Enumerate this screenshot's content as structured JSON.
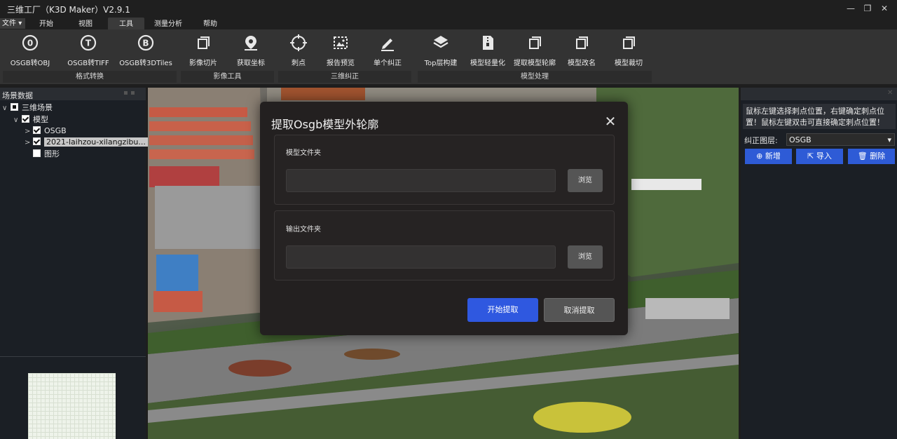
{
  "app": {
    "title": "三维工厂（K3D Maker）V2.9.1"
  },
  "menu": {
    "file": "文件",
    "tabs": [
      {
        "label": "开始"
      },
      {
        "label": "视图"
      },
      {
        "label": "工具",
        "active": true
      },
      {
        "label": "测量分析"
      },
      {
        "label": "帮助"
      }
    ]
  },
  "ribbon": {
    "buttons": [
      {
        "label": "OSGB转OBJ",
        "icon": "convert-o-icon"
      },
      {
        "label": "OSGB转TIFF",
        "icon": "convert-t-icon"
      },
      {
        "label": "OSGB转3DTiles",
        "icon": "convert-b-icon"
      },
      {
        "label": "影像切片",
        "icon": "slice-icon"
      },
      {
        "label": "获取坐标",
        "icon": "location-pin-icon"
      },
      {
        "label": "刺点",
        "icon": "crosshair-icon"
      },
      {
        "label": "报告预览",
        "icon": "image-preview-icon"
      },
      {
        "label": "单个纠正",
        "icon": "pencil-icon"
      },
      {
        "label": "Top层构建",
        "icon": "layers-icon"
      },
      {
        "label": "模型轻量化",
        "icon": "zip-file-icon"
      },
      {
        "label": "提取模型轮廓",
        "icon": "outline-icon"
      },
      {
        "label": "模型改名",
        "icon": "rename-icon"
      },
      {
        "label": "模型裁切",
        "icon": "crop-icon"
      }
    ],
    "groups": [
      {
        "label": "格式转换"
      },
      {
        "label": "影像工具"
      },
      {
        "label": "三维纠正"
      },
      {
        "label": "模型处理"
      }
    ]
  },
  "scene_panel": {
    "title": "场景数据",
    "tree": [
      {
        "label": "三维场景",
        "state": "partial"
      },
      {
        "label": "模型",
        "state": "checked"
      },
      {
        "label": "OSGB",
        "state": "checked"
      },
      {
        "label": "2021-laihzou-xilangzibu...",
        "state": "checked",
        "selected": true
      },
      {
        "label": "图形",
        "state": "unchecked"
      }
    ]
  },
  "right_panel": {
    "hint": "鼠标左键选择刺点位置，右键确定刺点位置！鼠标左键双击可直接确定刺点位置！",
    "layer_label": "纠正图层:",
    "layer_value": "OSGB",
    "buttons": {
      "add": "新增",
      "import": "导入",
      "delete": "删除"
    }
  },
  "dialog": {
    "title": "提取Osgb模型外轮廓",
    "model_folder_label": "模型文件夹",
    "model_folder_value": "",
    "output_folder_label": "输出文件夹",
    "output_folder_value": "",
    "browse": "浏览",
    "start": "开始提取",
    "cancel": "取消提取"
  },
  "colors": {
    "accent": "#2f58e0",
    "panel": "#1b1f25",
    "ribbon": "#333333"
  }
}
